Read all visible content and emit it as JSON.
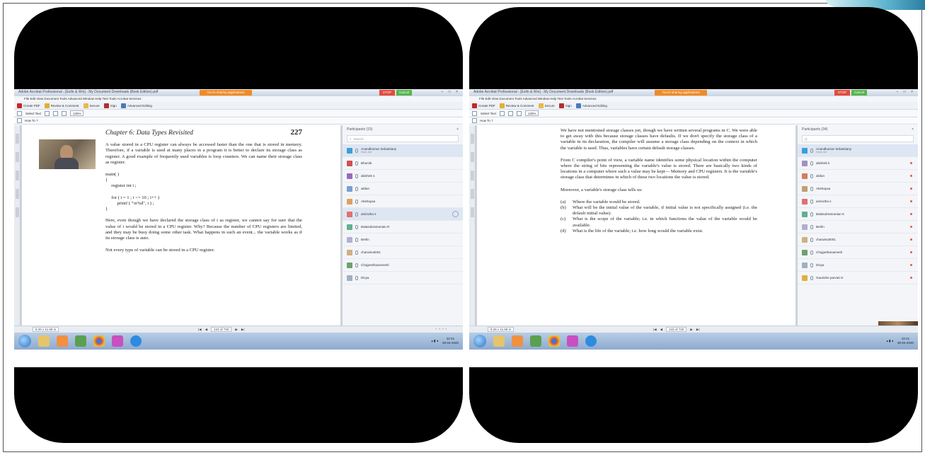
{
  "app": {
    "window_title": "Adobe Acrobat Professional - [Exife & Win] - My Document Downloads (Book Edition).pdf",
    "sharing_notice": "You're sharing applications",
    "stop_label": "STOP",
    "cancel_label": "Cancel",
    "menu": "File  Edit  View  Document  Tools  Advanced  Window  Help  Test Tools  Acrobat Services",
    "toolbar": [
      "Create PDF",
      "Review & Comment",
      "Secure",
      "Sign",
      "Advanced Editing"
    ],
    "toolbar2": {
      "select_text": "Select Text",
      "zoom": "125%"
    },
    "toolbar3": {
      "how_to": "How To ?"
    }
  },
  "left": {
    "doc": {
      "chapter_title": "Chapter 6: Data Types Revisited",
      "page_number": "227",
      "para1": "A value stored in a CPU register can always be accessed faster than the one that is stored in memory. Therefore, if a variable is used at many places in a program it is better to declare its storage class as register. A good example of frequently used variables is loop counters. We can name their storage class as register.",
      "code": "main( )\n{\n     register int i ;\n\n     for ( i = 1 ; i <= 10 ; i++ )\n          printf ( \"\\n%d\", i ) ;\n}",
      "para2": "Here, even though we have declared the storage class of i as register, we cannot say for sure that the value of i would be stored in a CPU register. Why? Because the number of CPU registers are limited, and they may be busy doing some other task. What happens in such an event... the variable works as if its storage class is auto.",
      "para3": "Not every type of variable can be stored in a CPU register."
    },
    "participants": {
      "header": "Participants (15)",
      "search": "Search",
      "items": [
        {
          "name": "Anandkumar Sebastiany",
          "sub": "Host, me",
          "color": "#3aa0d8"
        },
        {
          "name": "Bhumik",
          "sub": "",
          "color": "#d05050"
        },
        {
          "name": "abishek s",
          "sub": "",
          "color": "#9a6ab8"
        },
        {
          "name": "akilan",
          "sub": "",
          "color": "#7aa0d0"
        },
        {
          "name": "Akshayaa",
          "sub": "",
          "color": "#e0a060"
        },
        {
          "name": "amirutha s",
          "sub": "",
          "color": "#e07070"
        },
        {
          "name": "Balasubramanian R",
          "sub": "",
          "color": "#60b090"
        },
        {
          "name": "Berlin",
          "sub": "",
          "color": "#b0b0d0"
        },
        {
          "name": "charuleu0001",
          "sub": "",
          "color": "#d0b080"
        },
        {
          "name": "Chujpeethanamesh",
          "sub": "",
          "color": "#70a070"
        },
        {
          "name": "Divya",
          "sub": "",
          "color": "#a0b0c0"
        }
      ]
    },
    "status": {
      "size": "8.26 x 11.69 in",
      "page": "243 of 720"
    },
    "tray": {
      "time": "22:41",
      "date": "30-04-2020"
    }
  },
  "right": {
    "doc": {
      "para1": "We have not mentioned storage classes yet, though we have written several programs in C. We were able to get away with this because storage classes have defaults. If we don't specify the storage class of a variable in its declaration, the compiler will assume a storage class depending on the context in which the variable is used. Thus, variables have certain default storage classes.",
      "para2": "From C compiler's point of view, a variable name identifies some physical location within the computer where the string of bits representing the variable's value is stored. There are basically two kinds of locations in a computer where such a value may be kept— Memory and CPU registers. It is the variable's storage class that determines in which of these two locations the value is stored.",
      "para3": "Moreover, a variable's storage class tells us:",
      "list": [
        {
          "tag": "(a)",
          "text": "Where the variable would be stored."
        },
        {
          "tag": "(b)",
          "text": "What will be the initial value of the variable, if initial value is not specifically assigned (i.e. the default initial value)."
        },
        {
          "tag": "(c)",
          "text": "What is the scope of the variable; i.e. in which functions the value of the variable would be available."
        },
        {
          "tag": "(d)",
          "text": "What is the life of the variable; i.e. how long would the variable exist."
        }
      ]
    },
    "participants": {
      "header": "Participants (34)",
      "search": "Q",
      "items": [
        {
          "name": "Anandkumar Sebastiany",
          "sub": "Host, me",
          "color": "#3aa0d8"
        },
        {
          "name": "abishek k",
          "sub": "",
          "color": "#a090c0"
        },
        {
          "name": "akilan",
          "sub": "",
          "color": "#d08060"
        },
        {
          "name": "Akshayaa",
          "sub": "",
          "color": "#c0a070"
        },
        {
          "name": "amirutha s",
          "sub": "",
          "color": "#e07070"
        },
        {
          "name": "Balasubramanian K",
          "sub": "",
          "color": "#60b090"
        },
        {
          "name": "Berlin",
          "sub": "",
          "color": "#b0b0d0"
        },
        {
          "name": "charuleu0001",
          "sub": "",
          "color": "#d0b080"
        },
        {
          "name": "Chujpethanamesh",
          "sub": "",
          "color": "#70a070"
        },
        {
          "name": "Divya",
          "sub": "",
          "color": "#a0b0c0"
        },
        {
          "name": "Gaurishe parvati G",
          "sub": "",
          "color": "#e0b040"
        }
      ]
    },
    "status": {
      "size": "8.26 x 11.69 in",
      "page": "243 of 720"
    },
    "tray": {
      "time": "22:41",
      "date": "30-04-2020"
    }
  }
}
